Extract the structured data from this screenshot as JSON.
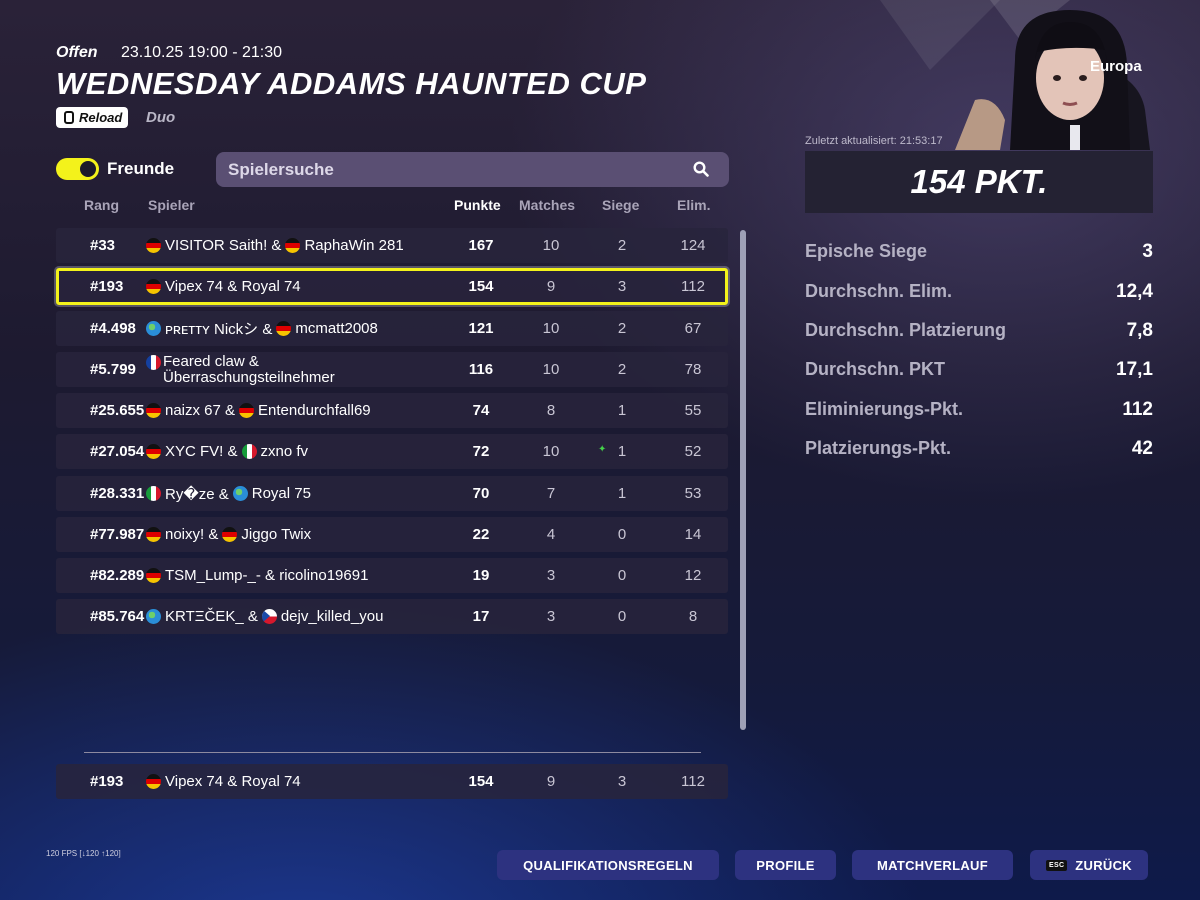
{
  "event": {
    "status": "Offen",
    "date_range": "23.10.25 19:00 - 21:30",
    "title": "WEDNESDAY ADDAMS HAUNTED CUP",
    "reload_badge": "Reload",
    "mode": "Duo"
  },
  "controls": {
    "friends_label": "Freunde",
    "friends_toggle_on": true,
    "search_placeholder": "Spielersuche"
  },
  "table": {
    "headers": {
      "rank": "Rang",
      "player": "Spieler",
      "points": "Punkte",
      "matches": "Matches",
      "wins": "Siege",
      "elims": "Elim."
    },
    "rows": [
      {
        "rank": "#33",
        "players": "VISITOR Saith! & ",
        "players2": "RaphaWin 281",
        "points": "167",
        "matches": "10",
        "wins": "2",
        "elims": "124"
      },
      {
        "rank": "#193",
        "players": "Vipex 74 & Royal 74",
        "players2": "",
        "points": "154",
        "matches": "9",
        "wins": "3",
        "elims": "112"
      },
      {
        "rank": "#4.498",
        "players": "ᴘʀᴇᴛᴛʏ Nickシ & ",
        "players2": "mcmatt2008",
        "points": "121",
        "matches": "10",
        "wins": "2",
        "elims": "67"
      },
      {
        "rank": "#5.799",
        "players": "Feared claw & Überraschungsteilnehmer",
        "players2": "",
        "points": "116",
        "matches": "10",
        "wins": "2",
        "elims": "78"
      },
      {
        "rank": "#25.655",
        "players": "naizx 67 & ",
        "players2": "Entendurchfall69",
        "points": "74",
        "matches": "8",
        "wins": "1",
        "elims": "55"
      },
      {
        "rank": "#27.054",
        "players": "XYC FV! & ",
        "players2": "zxno fv",
        "points": "72",
        "matches": "10",
        "wins": "1",
        "elims": "52"
      },
      {
        "rank": "#28.331",
        "players": "Ry�ze & ",
        "players2": "Royal 75",
        "points": "70",
        "matches": "7",
        "wins": "1",
        "elims": "53"
      },
      {
        "rank": "#77.987",
        "players": "noixy! & ",
        "players2": "Jiggo Twix",
        "points": "22",
        "matches": "4",
        "wins": "0",
        "elims": "14"
      },
      {
        "rank": "#82.289",
        "players": "TSM_Lump-_- & ricolino19691",
        "players2": "",
        "points": "19",
        "matches": "3",
        "wins": "0",
        "elims": "12"
      },
      {
        "rank": "#85.764",
        "players": "KRTΞČEK_ & ",
        "players2": "dejv_killed_you",
        "points": "17",
        "matches": "3",
        "wins": "0",
        "elims": "8"
      }
    ],
    "pinned": {
      "rank": "#193",
      "players": "Vipex 74 & Royal 74",
      "points": "154",
      "matches": "9",
      "wins": "3",
      "elims": "112"
    }
  },
  "summary": {
    "region": "Europa",
    "updated": "Zuletzt aktualisiert: 21:53:17",
    "points": "154 PKT.",
    "stats": [
      {
        "label": "Epische Siege",
        "value": "3"
      },
      {
        "label": "Durchschn. Elim.",
        "value": "12,4"
      },
      {
        "label": "Durchschn. Platzierung",
        "value": "7,8"
      },
      {
        "label": "Durchschn. PKT",
        "value": "17,1"
      },
      {
        "label": "Eliminierungs-Pkt.",
        "value": "112"
      },
      {
        "label": "Platzierungs-Pkt.",
        "value": "42"
      }
    ]
  },
  "footer": {
    "fps": "120 FPS [↓120 ↑120]",
    "buttons": {
      "rules": "QUALIFIKATIONSREGELN",
      "profiles": "PROFILE",
      "history": "MATCHVERLAUF",
      "back": "ZURÜCK",
      "back_key": "ESC"
    }
  },
  "colors": {
    "accent_yellow": "#f3f21b",
    "button_blue": "#2d3280"
  }
}
